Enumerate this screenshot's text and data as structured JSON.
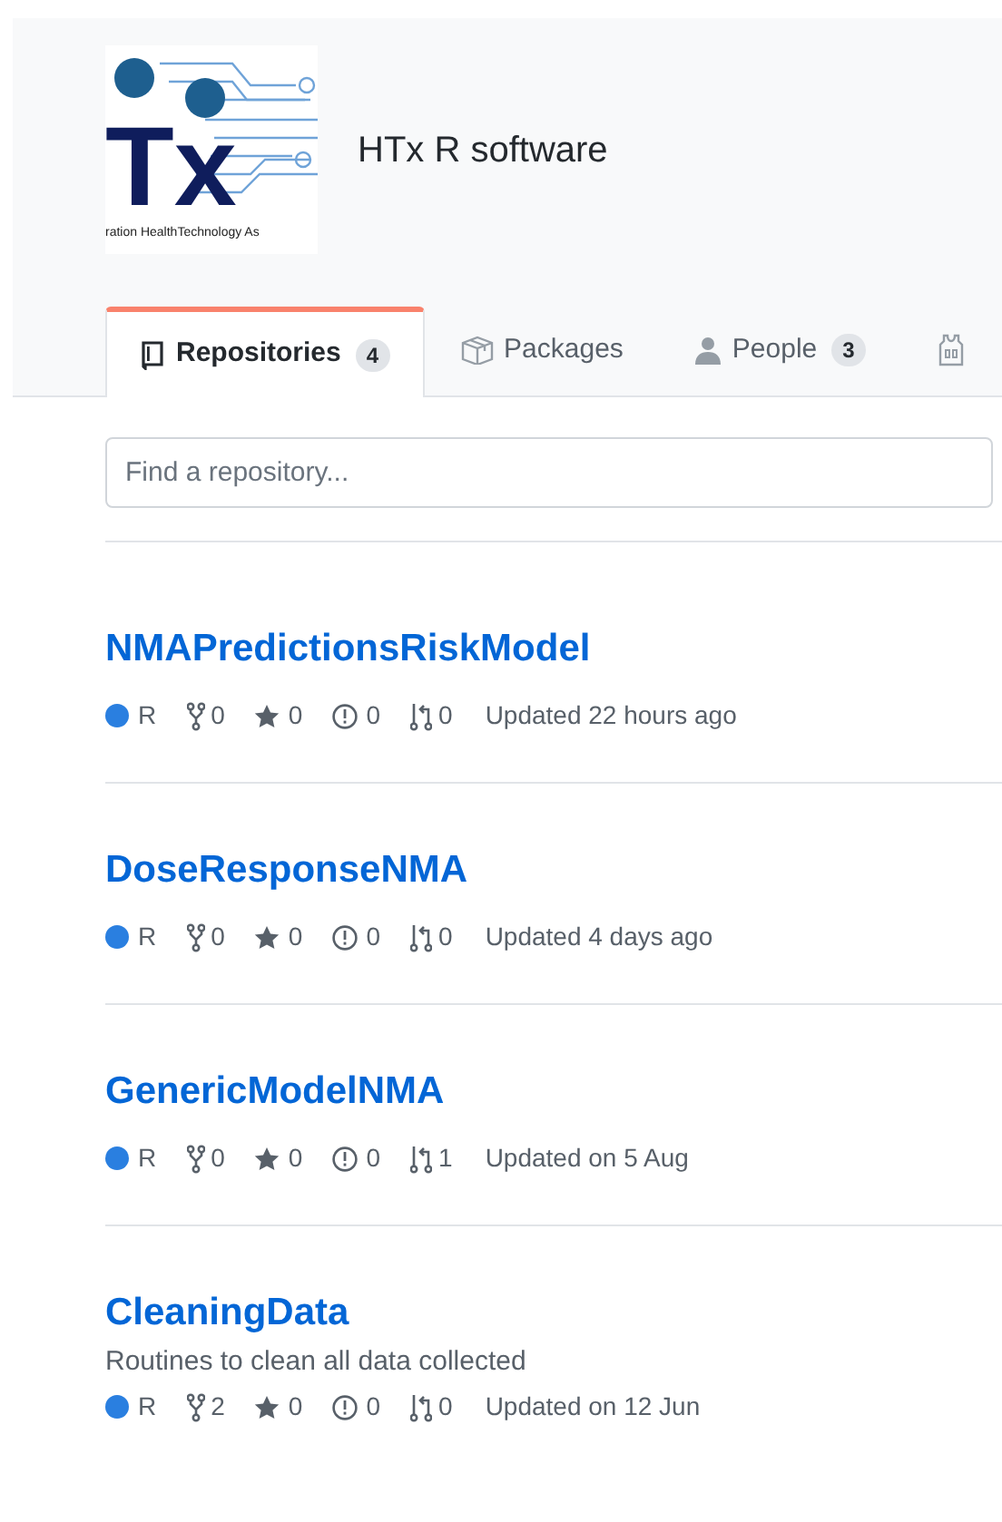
{
  "org": {
    "logo_text": "Tx",
    "logo_caption": "ration HealthTechnology As",
    "name": "HTx R software"
  },
  "tabs": [
    {
      "label": "Repositories",
      "count": "4",
      "kind": "book",
      "selected": true
    },
    {
      "label": "Packages",
      "kind": "package",
      "selected": false
    },
    {
      "label": "People",
      "count": "3",
      "kind": "person",
      "selected": false
    },
    {
      "kind": "jersey",
      "selected": false
    }
  ],
  "search": {
    "placeholder": "Find a repository..."
  },
  "repositories": [
    {
      "name": "NMAPredictionsRiskModel",
      "language": "R",
      "color": "#2a7fe0",
      "forks": "0",
      "stars": "0",
      "issues": "0",
      "pulls": "0",
      "updated": "Updated 22 hours ago"
    },
    {
      "name": "DoseResponseNMA",
      "language": "R",
      "color": "#2a7fe0",
      "forks": "0",
      "stars": "0",
      "issues": "0",
      "pulls": "0",
      "updated": "Updated 4 days ago"
    },
    {
      "name": "GenericModelNMA",
      "language": "R",
      "color": "#2a7fe0",
      "forks": "0",
      "stars": "0",
      "issues": "0",
      "pulls": "1",
      "updated": "Updated on 5 Aug"
    },
    {
      "name": "CleaningData",
      "description": "Routines to clean all data collected",
      "language": "R",
      "color": "#2a7fe0",
      "forks": "2",
      "stars": "0",
      "issues": "0",
      "pulls": "0",
      "updated": "Updated on 12 Jun"
    }
  ]
}
